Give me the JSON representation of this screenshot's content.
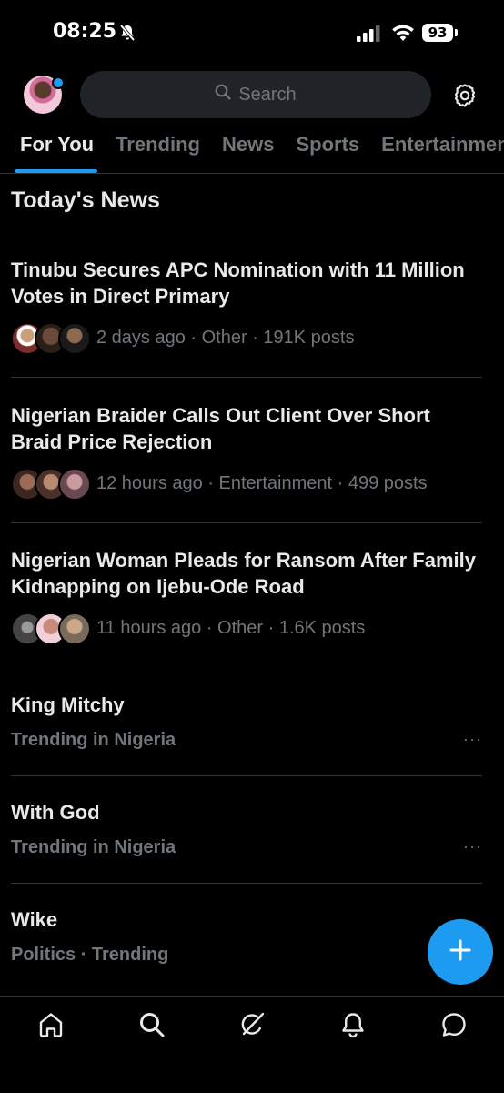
{
  "status_bar": {
    "time": "08:25",
    "battery": "93"
  },
  "header": {
    "search_placeholder": "Search"
  },
  "tabs": [
    {
      "label": "For You",
      "active": true
    },
    {
      "label": "Trending"
    },
    {
      "label": "News"
    },
    {
      "label": "Sports"
    },
    {
      "label": "Entertainment"
    }
  ],
  "section_title": "Today's News",
  "news": [
    {
      "headline": "Tinubu Secures APC Nomination with 11 Million Votes in Direct Primary",
      "meta": "2 days ago · Other · 191K posts"
    },
    {
      "headline": "Nigerian Braider Calls Out Client Over Short Braid Price Rejection",
      "meta": "12 hours ago · Entertainment · 499 posts"
    },
    {
      "headline": "Nigerian Woman Pleads for Ransom After Family Kidnapping on Ijebu-Ode Road",
      "meta": "11 hours ago · Other · 1.6K posts"
    }
  ],
  "trends": [
    {
      "name": "King Mitchy",
      "context": "Trending in Nigeria",
      "more": "···"
    },
    {
      "name": "With God",
      "context": "Trending in Nigeria",
      "more": "···"
    },
    {
      "name": "Wike",
      "context": "Politics · Trending"
    }
  ],
  "colors": {
    "accent": "#1d9bf0",
    "background": "#000000",
    "muted": "#71767b"
  },
  "bottom_nav": [
    "home-icon",
    "search-icon",
    "grok-icon",
    "notifications-icon",
    "messages-icon"
  ]
}
